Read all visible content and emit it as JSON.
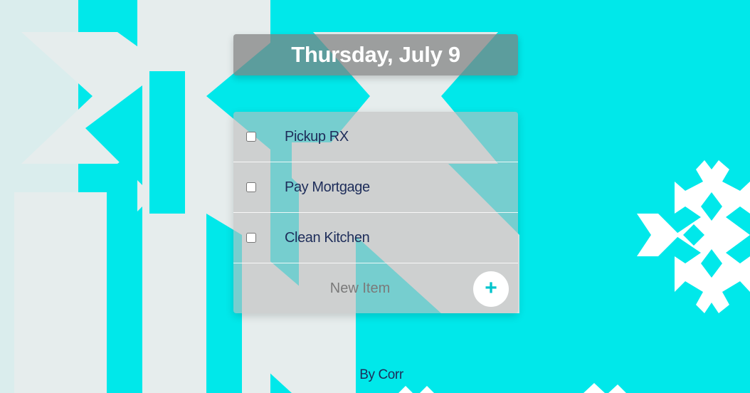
{
  "header": {
    "date": "Thursday, July 9"
  },
  "todos": [
    {
      "label": "Pickup RX",
      "checked": false
    },
    {
      "label": "Pay Mortgage",
      "checked": false
    },
    {
      "label": "Clean Kitchen",
      "checked": false
    }
  ],
  "new_item": {
    "placeholder": "New Item",
    "add_icon": "plus-icon"
  },
  "footer": {
    "credit": "By Corr"
  },
  "colors": {
    "background": "#00e8ea",
    "snowflake": "#e6ecec",
    "accent": "#00c4cc"
  }
}
